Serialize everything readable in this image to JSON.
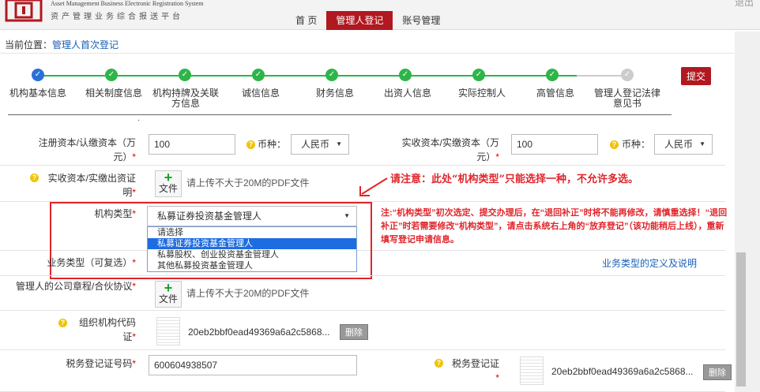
{
  "header": {
    "logo_en": "Asset Management Business Electronic Registration System",
    "logo_cn": "资产管理业务综合报送平台",
    "nav": [
      "首 页",
      "管理人登记",
      "账号管理"
    ],
    "user": "退出"
  },
  "breadcrumb": {
    "prefix": "当前位置：",
    "link": "管理人首次登记"
  },
  "submit_label": "提交",
  "steps": [
    {
      "label": "机构基本信息",
      "status": "current"
    },
    {
      "label": "相关制度信息",
      "status": "done"
    },
    {
      "label": "机构持牌及关联方信息",
      "status": "done"
    },
    {
      "label": "诚信信息",
      "status": "done"
    },
    {
      "label": "财务信息",
      "status": "done"
    },
    {
      "label": "出资人信息",
      "status": "done"
    },
    {
      "label": "实际控制人",
      "status": "done"
    },
    {
      "label": "高管信息",
      "status": "done"
    },
    {
      "label": "管理人登记法律意见书",
      "status": "todo"
    }
  ],
  "form": {
    "reg_capital_label": "注册资本/认缴资本（万元）",
    "reg_capital_value": "100",
    "currency_label": "币种：",
    "currency_value": "人民币",
    "paid_capital_label": "实收资本/实缴资本（万元）",
    "paid_capital_value": "100",
    "currency2_value": "人民币",
    "paid_proof_label": "实收资本/实缴出资证明",
    "upload_label": "文件",
    "upload_hint": "请上传不大于20M的PDF文件",
    "org_type_label": "机构类型",
    "org_type_value": "私募证券投资基金管理人",
    "org_type_options": [
      "请选择",
      "私募证券投资基金管理人",
      "私募股权、创业投资基金管理人",
      "其他私募投资基金管理人"
    ],
    "biz_type_label": "业务类型（可复选）",
    "biz_type_link": "业务类型的定义及说明",
    "articles_label": "管理人的公司章程/合伙协议",
    "articles_hint": "请上传不大于20M的PDF文件",
    "org_code_label": "组织机构代码证",
    "org_code_file": "20eb2bbf0ead49369a6a2c5868...",
    "delete_label": "删除",
    "tax_no_label": "税务登记证号码",
    "tax_no_value": "600604938507",
    "tax_cert_label": "税务登记证",
    "tax_cert_file": "20eb2bbf0ead49369a6a2c5868..."
  },
  "notice_short": "请注意：此处“机构类型”只能选择一种，不允许多选。",
  "notice_long": "注:“机构类型”初次选定、提交办理后，在“退回补正”时将不能再修改，请慎重选择！“退回补正”时若需要修改“机构类型”，请点击系统右上角的“放弃登记”（该功能稍后上线），重新填写登记申请信息。",
  "colors": {
    "brand": "#b1181f",
    "done": "#2eb54a",
    "current": "#2a6fd8",
    "alert": "#e0252b"
  }
}
